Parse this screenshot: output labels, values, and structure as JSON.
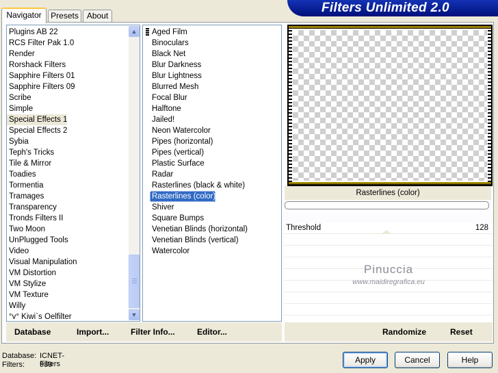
{
  "banner": {
    "title": "Filters Unlimited 2.0"
  },
  "tabs": [
    {
      "label": "Navigator",
      "active": true
    },
    {
      "label": "Presets",
      "active": false
    },
    {
      "label": "About",
      "active": false
    }
  ],
  "categories": {
    "highlighted": "Special Effects 1",
    "items": [
      "Plugins AB 22",
      "RCS Filter Pak 1.0",
      "Render",
      "Rorshack Filters",
      "Sapphire Filters 01",
      "Sapphire Filters 09",
      "Scribe",
      "Simple",
      "Special Effects 1",
      "Special Effects 2",
      "Sybia",
      "Teph's Tricks",
      "Tile & Mirror",
      "Toadies",
      "Tormentia",
      "Tramages",
      "Transparency",
      "Tronds Filters II",
      "Two Moon",
      "UnPlugged Tools",
      "Video",
      "Visual Manipulation",
      "VM Distortion",
      "VM Stylize",
      "VM Texture",
      "Willy",
      "°v° Kiwi`s Oelfilter"
    ]
  },
  "filters": {
    "selected": "Rasterlines (color)",
    "items": [
      "Aged Film",
      "Binoculars",
      "Black Net",
      "Blur Darkness",
      "Blur Lightness",
      "Blurred Mesh",
      "Focal Blur",
      "Halftone",
      "Jailed!",
      "Neon Watercolor",
      "Pipes (horizontal)",
      "Pipes (vertical)",
      "Plastic Surface",
      "Radar",
      "Rasterlines (black & white)",
      "Rasterlines (color)",
      "Shiver",
      "Square Bumps",
      "Venetian Blinds (horizontal)",
      "Venetian Blinds (vertical)",
      "Watercolor"
    ]
  },
  "preview": {
    "filter_name": "Rasterlines (color)",
    "colors": {
      "stripe_accent": "#ffd800",
      "checker": "#cfcfcf"
    }
  },
  "controls": [
    {
      "label": "Threshold",
      "value": "128"
    }
  ],
  "watermark": {
    "line1": "Pinuccia",
    "line2": "www.maidiregrafica.eu"
  },
  "actions_left": [
    "Database",
    "Import...",
    "Filter Info...",
    "Editor..."
  ],
  "actions_right": [
    "Randomize",
    "Reset"
  ],
  "status": {
    "database_label": "Database:",
    "database_value": "ICNET-Filters",
    "filters_label": "Filters:",
    "filters_value": "939"
  },
  "buttons": {
    "apply": "Apply",
    "cancel": "Cancel",
    "help": "Help"
  },
  "icons": {
    "scroll_up": "chevron-up-icon",
    "scroll_down": "chevron-down-icon"
  },
  "accent": "#316ac5"
}
